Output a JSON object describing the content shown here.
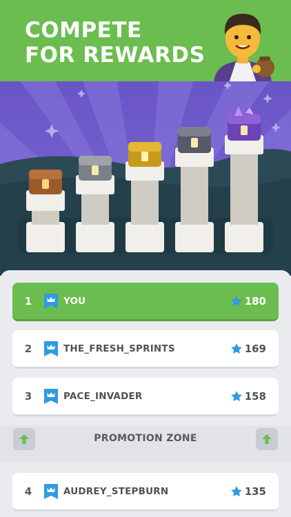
{
  "header": {
    "line1": "COMPETE",
    "line2": "FOR REWARDS"
  },
  "colors": {
    "green": "#6bbd4f",
    "purple_sky": "#6d58c9",
    "star_blue": "#2f9be0"
  },
  "leaderboard": {
    "rows": [
      {
        "rank": "1",
        "name": "YOU",
        "score": "180"
      },
      {
        "rank": "2",
        "name": "THE_FRESH_SPRINTS",
        "score": "169"
      },
      {
        "rank": "3",
        "name": "PACE_INVADER",
        "score": "158"
      },
      {
        "rank": "4",
        "name": "AUDREY_STEPBURN",
        "score": "135"
      }
    ],
    "promotion_label": "PROMOTION ZONE"
  },
  "icons": {
    "rank_flag": "crown-flag-icon",
    "score": "star-icon",
    "promotion": "arrow-up-icon"
  }
}
